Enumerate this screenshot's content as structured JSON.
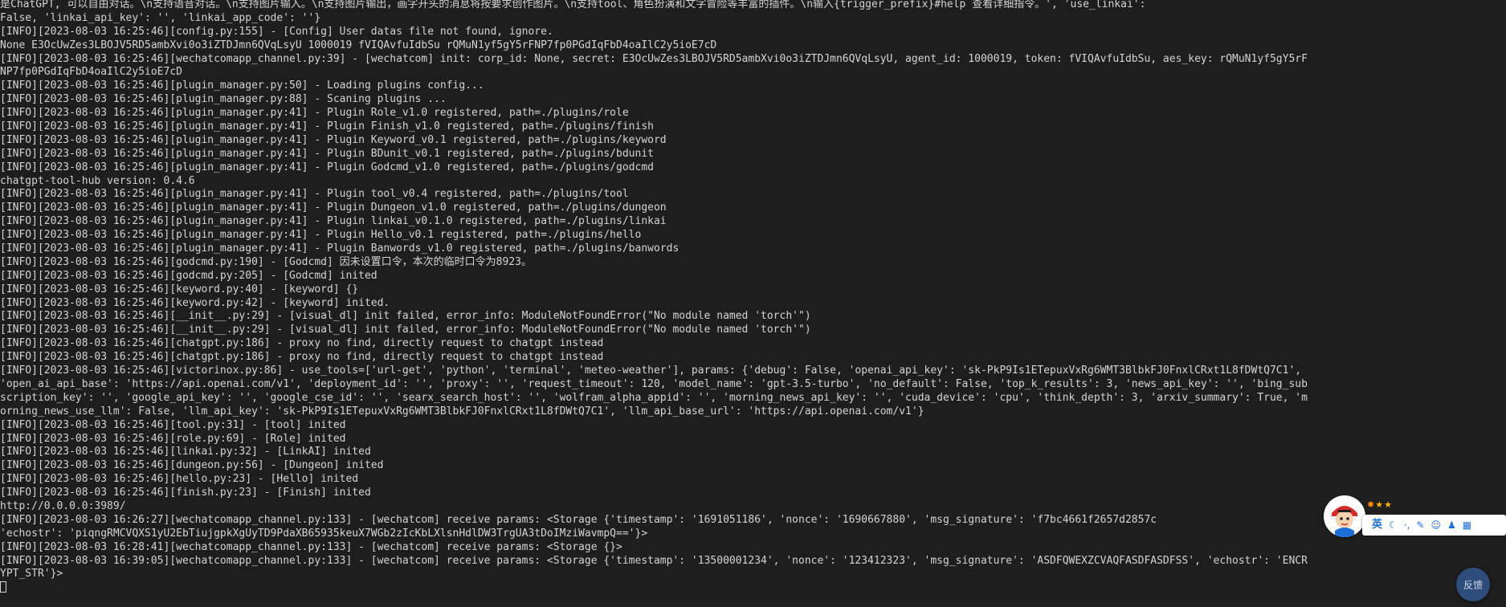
{
  "terminal": {
    "lines": [
      "是ChatGPT, 可以自由对话。\\n支持语音对话。\\n支持图片输入。\\n支持图片输出，画字开头的消息将按要求创作图片。\\n支持tool、角色扮演和文字冒险等丰富的插件。\\n输入{trigger_prefix}#help 查看详细指令。', 'use_linkai':",
      "False, 'linkai_api_key': '', 'linkai_app_code': ''}",
      "[INFO][2023-08-03 16:25:46][config.py:155] - [Config] User datas file not found, ignore.",
      "None E3OcUwZes3LBOJV5RD5ambXvi0o3iZTDJmn6QVqLsyU 1000019 fVIQAvfuIdbSu rQMuN1yf5gY5rFNP7fp0PGdIqFbD4oaIlC2y5ioE7cD",
      "[INFO][2023-08-03 16:25:46][wechatcomapp_channel.py:39] - [wechatcom] init: corp_id: None, secret: E3OcUwZes3LBOJV5RD5ambXvi0o3iZTDJmn6QVqLsyU, agent_id: 1000019, token: fVIQAvfuIdbSu, aes_key: rQMuN1yf5gY5rF",
      "NP7fp0PGdIqFbD4oaIlC2y5ioE7cD",
      "[INFO][2023-08-03 16:25:46][plugin_manager.py:50] - Loading plugins config...",
      "[INFO][2023-08-03 16:25:46][plugin_manager.py:88] - Scaning plugins ...",
      "[INFO][2023-08-03 16:25:46][plugin_manager.py:41] - Plugin Role_v1.0 registered, path=./plugins/role",
      "[INFO][2023-08-03 16:25:46][plugin_manager.py:41] - Plugin Finish_v1.0 registered, path=./plugins/finish",
      "[INFO][2023-08-03 16:25:46][plugin_manager.py:41] - Plugin Keyword_v0.1 registered, path=./plugins/keyword",
      "[INFO][2023-08-03 16:25:46][plugin_manager.py:41] - Plugin BDunit_v0.1 registered, path=./plugins/bdunit",
      "[INFO][2023-08-03 16:25:46][plugin_manager.py:41] - Plugin Godcmd_v1.0 registered, path=./plugins/godcmd",
      "chatgpt-tool-hub version: 0.4.6",
      "[INFO][2023-08-03 16:25:46][plugin_manager.py:41] - Plugin tool_v0.4 registered, path=./plugins/tool",
      "[INFO][2023-08-03 16:25:46][plugin_manager.py:41] - Plugin Dungeon_v1.0 registered, path=./plugins/dungeon",
      "[INFO][2023-08-03 16:25:46][plugin_manager.py:41] - Plugin linkai_v0.1.0 registered, path=./plugins/linkai",
      "[INFO][2023-08-03 16:25:46][plugin_manager.py:41] - Plugin Hello_v0.1 registered, path=./plugins/hello",
      "[INFO][2023-08-03 16:25:46][plugin_manager.py:41] - Plugin Banwords_v1.0 registered, path=./plugins/banwords",
      "[INFO][2023-08-03 16:25:46][godcmd.py:190] - [Godcmd] 因未设置口令，本次的临时口令为8923。",
      "[INFO][2023-08-03 16:25:46][godcmd.py:205] - [Godcmd] inited",
      "[INFO][2023-08-03 16:25:46][keyword.py:40] - [keyword] {}",
      "[INFO][2023-08-03 16:25:46][keyword.py:42] - [keyword] inited.",
      "[INFO][2023-08-03 16:25:46][__init__.py:29] - [visual_dl] init failed, error_info: ModuleNotFoundError(\"No module named 'torch'\")",
      "[INFO][2023-08-03 16:25:46][__init__.py:29] - [visual_dl] init failed, error_info: ModuleNotFoundError(\"No module named 'torch'\")",
      "[INFO][2023-08-03 16:25:46][chatgpt.py:186] - proxy no find, directly request to chatgpt instead",
      "[INFO][2023-08-03 16:25:46][chatgpt.py:186] - proxy no find, directly request to chatgpt instead",
      "[INFO][2023-08-03 16:25:46][victorinox.py:86] - use_tools=['url-get', 'python', 'terminal', 'meteo-weather'], params: {'debug': False, 'openai_api_key': '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',",
      "'open_ai_api_base': 'https://api.openai.com/v1', 'deployment_id': '', 'proxy': '', 'request_timeout': 120, 'model_name': 'gpt-3.5-turbo', 'no_default': False, 'top_k_results': 3, 'news_api_key': '', 'bing_sub",
      "scription_key': '', 'google_api_key': '', 'google_cse_id': '', 'searx_search_host': '', 'wolfram_alpha_appid': '', 'morning_news_api_key': '', 'cuda_device': 'cpu', 'think_depth': 3, 'arxiv_summary': True, 'm",
      "orning_news_use_llm': False, 'llm_api_key': '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', 'llm_api_base_url': 'https://api.openai.com/v1'}",
      "[INFO][2023-08-03 16:25:46][tool.py:31] - [tool] inited",
      "[INFO][2023-08-03 16:25:46][role.py:69] - [Role] inited",
      "[INFO][2023-08-03 16:25:46][linkai.py:32] - [LinkAI] inited",
      "[INFO][2023-08-03 16:25:46][dungeon.py:56] - [Dungeon] inited",
      "[INFO][2023-08-03 16:25:46][hello.py:23] - [Hello] inited",
      "[INFO][2023-08-03 16:25:46][finish.py:23] - [Finish] inited",
      "http://0.0.0.0:3989/",
      "[INFO][2023-08-03 16:26:27][wechatcomapp_channel.py:133] - [wechatcom] receive params: <Storage {'timestamp': '1691051186', 'nonce': '1690667880', 'msg_signature': 'f7bc4661f2657d2857c",
      "'echostr': 'piqngRMCVQXS1yU2EbTiujgpkXgUyTD9PdaXB65935keuX7WGb2zIcKbLXlsnHdlDW3TrgUA3tDoIMziWavmpQ=='}>",
      "[INFO][2023-08-03 16:28:41][wechatcomapp_channel.py:133] - [wechatcom] receive params: <Storage {}>",
      "[INFO][2023-08-03 16:39:05][wechatcomapp_channel.py:133] - [wechatcom] receive params: <Storage {'timestamp': '13500001234', 'nonce': '123412323', 'msg_signature': 'ASDFQWEXZCVAQFASDFASDFSS', 'echostr': 'ENCR",
      "YPT_STR'}>"
    ]
  },
  "ime": {
    "lang_label": "英",
    "moon_icon": "moon-icon",
    "punct_icon": "punctuation-icon",
    "wrench_icon": "wrench-icon",
    "smile_icon": "emoji-icon",
    "shirt_icon": "skin-icon",
    "grid_icon": "toolbox-icon",
    "avatar_icon": "mascot-avatar-icon",
    "stars_icon": "level-stars-icon"
  },
  "feedback": {
    "label": "反馈"
  },
  "colors": {
    "background": "#1e1e1e",
    "text": "#d4d4d4",
    "ime_accent": "#1e6fd9",
    "feedback_bg": "#2f4d7a"
  }
}
